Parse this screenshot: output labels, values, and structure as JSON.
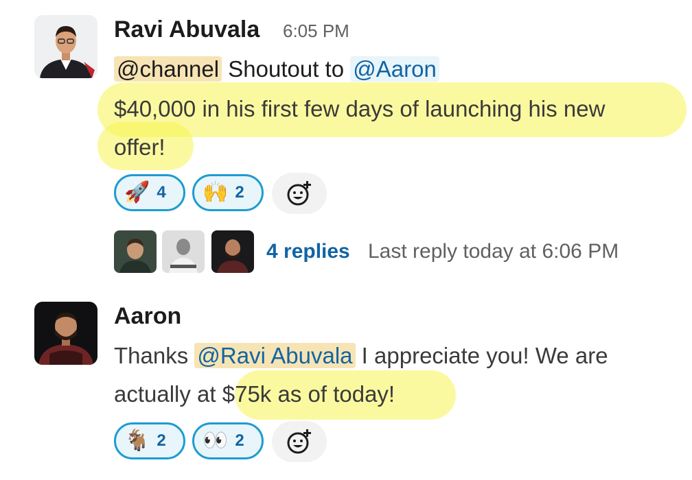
{
  "messages": [
    {
      "author": "Ravi Abuvala",
      "time": "6:05 PM",
      "mention_channel": "@channel",
      "text_part1": " Shoutout to ",
      "mention_user": "@Aaron",
      "line2": "$40,000 in his first few days of launching his new",
      "line3": "offer!",
      "reactions": [
        {
          "emoji_name": "rocket-emoji",
          "emoji": "🚀",
          "count": "4"
        },
        {
          "emoji_name": "raised-hands-emoji",
          "emoji": "🙌",
          "count": "2"
        }
      ],
      "thread": {
        "replies_label": "4 replies",
        "last_reply_label": "Last reply today at 6:06 PM"
      }
    },
    {
      "author": "Aaron",
      "text_part1": "Thanks ",
      "mention_user": "@Ravi Abuvala",
      "text_part2": " I appreciate you! We are",
      "line2": "actually at $75k as of today!",
      "reactions": [
        {
          "emoji_name": "goat-emoji",
          "emoji": "🐐",
          "count": "2"
        },
        {
          "emoji_name": "eyes-emoji",
          "emoji": "👀",
          "count": "2"
        }
      ]
    }
  ],
  "colors": {
    "link": "#1264a3",
    "highlight": "#f8f450",
    "reaction_border": "#1d9bd1"
  }
}
